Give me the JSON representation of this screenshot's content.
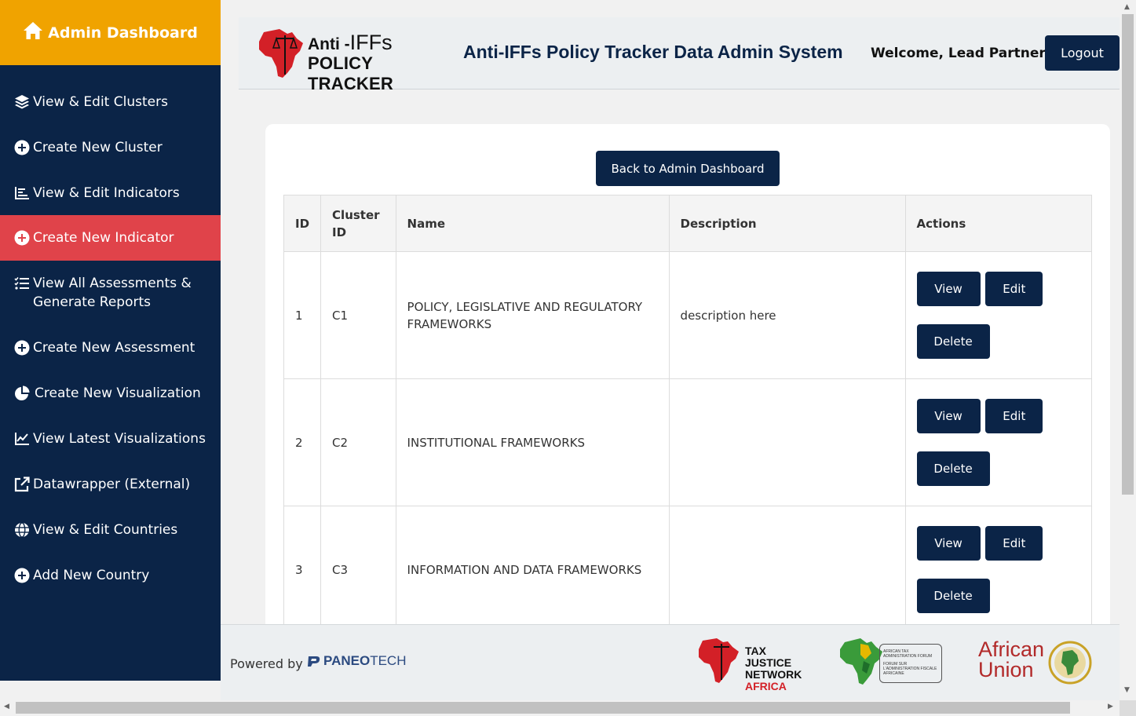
{
  "sidebar": {
    "brand": "Admin Dashboard",
    "items": [
      {
        "label": "View & Edit Clusters",
        "icon": "layers-icon"
      },
      {
        "label": "Create New Cluster",
        "icon": "plus-circle-icon"
      },
      {
        "label": "View & Edit Indicators",
        "icon": "bar-chart-icon"
      },
      {
        "label": "Create New Indicator",
        "icon": "plus-circle-icon"
      },
      {
        "label": "View All Assessments & Generate Reports",
        "icon": "checklist-icon"
      },
      {
        "label": "Create New Assessment",
        "icon": "plus-circle-icon"
      },
      {
        "label": "Create New Visualization",
        "icon": "pie-chart-icon"
      },
      {
        "label": "View Latest Visualizations",
        "icon": "line-chart-icon"
      },
      {
        "label": "Datawrapper (External)",
        "icon": "external-link-icon"
      },
      {
        "label": "View & Edit Countries",
        "icon": "globe-icon"
      },
      {
        "label": "Add New Country",
        "icon": "plus-circle-icon"
      }
    ]
  },
  "header": {
    "logo_anti": "Anti -",
    "logo_iffs": "IFFs",
    "logo_policy": "POLICY TRACKER",
    "title": "Anti-IFFs Policy Tracker Data Admin System",
    "welcome": "Welcome, Lead Partner!",
    "logout": "Logout"
  },
  "main": {
    "back_button": "Back to Admin Dashboard",
    "columns": [
      "ID",
      "Cluster ID",
      "Name",
      "Description",
      "Actions"
    ],
    "rows": [
      {
        "id": "1",
        "cluster_id": "C1",
        "name": "POLICY, LEGISLATIVE AND REGULATORY FRAMEWORKS",
        "description": "description here"
      },
      {
        "id": "2",
        "cluster_id": "C2",
        "name": "INSTITUTIONAL FRAMEWORKS",
        "description": ""
      },
      {
        "id": "3",
        "cluster_id": "C3",
        "name": "INFORMATION AND DATA FRAMEWORKS",
        "description": ""
      }
    ],
    "actions": {
      "view": "View",
      "edit": "Edit",
      "delete": "Delete"
    }
  },
  "footer": {
    "powered_by": "Powered by",
    "paneo_a": "PANEO",
    "paneo_b": "TECH",
    "tjn_1": "TAX JUSTICE",
    "tjn_2": "NETWORK",
    "tjn_3": "AFRICA",
    "ataf_1": "AFRICAN TAX ADMINISTRATION FORUM",
    "ataf_2": "FORUM SUR L'ADMINISTRATION FISCALE AFRICAINE",
    "au_1": "African",
    "au_2": "Union"
  },
  "colors": {
    "navy": "#0b2447",
    "accent_orange": "#f0a300",
    "active_red": "#e0434a"
  }
}
